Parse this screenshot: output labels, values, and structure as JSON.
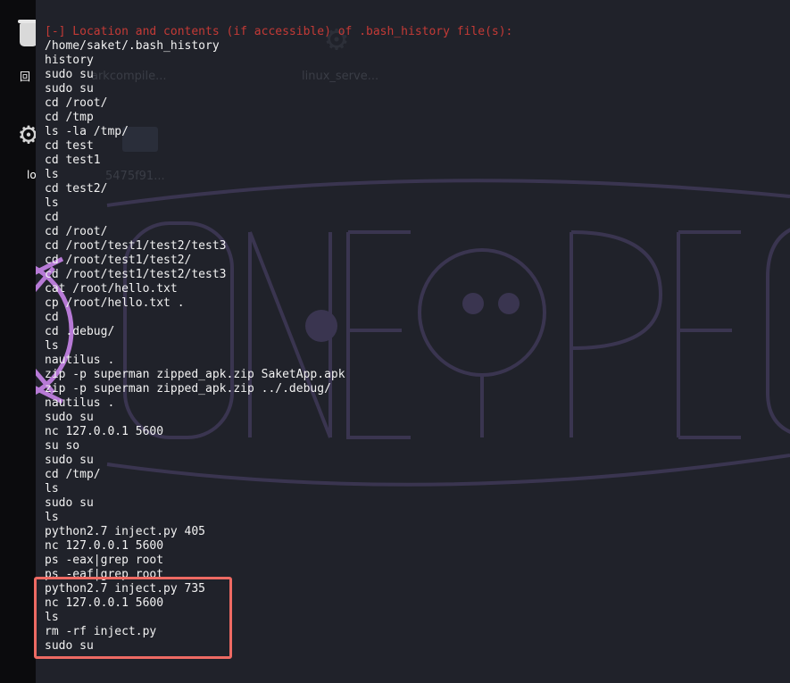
{
  "desktop": {
    "icons": [
      {
        "name": "trash-icon",
        "label": "回"
      },
      {
        "name": "gear-icon",
        "label": "lo"
      }
    ],
    "background_labels": [
      "arkcompile...",
      "linux_serve...",
      "5475f91..."
    ]
  },
  "terminal": {
    "header": "[-] Location and contents (if accessible) of .bash_history file(s):",
    "lines": [
      "/home/saket/.bash_history",
      "history",
      "sudo su",
      "sudo su",
      "cd /root/",
      "cd /tmp",
      "ls -la /tmp/",
      "cd test",
      "cd test1",
      "ls",
      "cd test2/",
      "ls",
      "cd",
      "cd /root/",
      "cd /root/test1/test2/test3",
      "cd /root/test1/test2/",
      "cd /root/test1/test2/test3",
      "cat /root/hello.txt",
      "cp /root/hello.txt .",
      "cd",
      "cd .debug/",
      "ls",
      "nautilus .",
      "zip -p superman zipped_apk.zip SaketApp.apk",
      "zip -p superman zipped_apk.zip ../.debug/",
      "nautilus .",
      "sudo su",
      "nc 127.0.0.1 5600",
      "su so",
      "sudo su",
      "cd /tmp/",
      "ls",
      "sudo su",
      "ls",
      "python2.7 inject.py 405",
      "nc 127.0.0.1 5600",
      "ps -eax|grep root",
      "ps -eaf|grep root",
      "python2.7 inject.py 735",
      "nc 127.0.0.1 5600",
      "ls",
      "rm -rf inject.py",
      "sudo su"
    ]
  },
  "colors": {
    "terminal_bg": "#20222a",
    "header_red": "#c43a36",
    "text": "#f2f2f2",
    "highlight_border": "#ee6a63",
    "watermark": "#3a3550",
    "watermark_accent": "#b77ad6"
  }
}
